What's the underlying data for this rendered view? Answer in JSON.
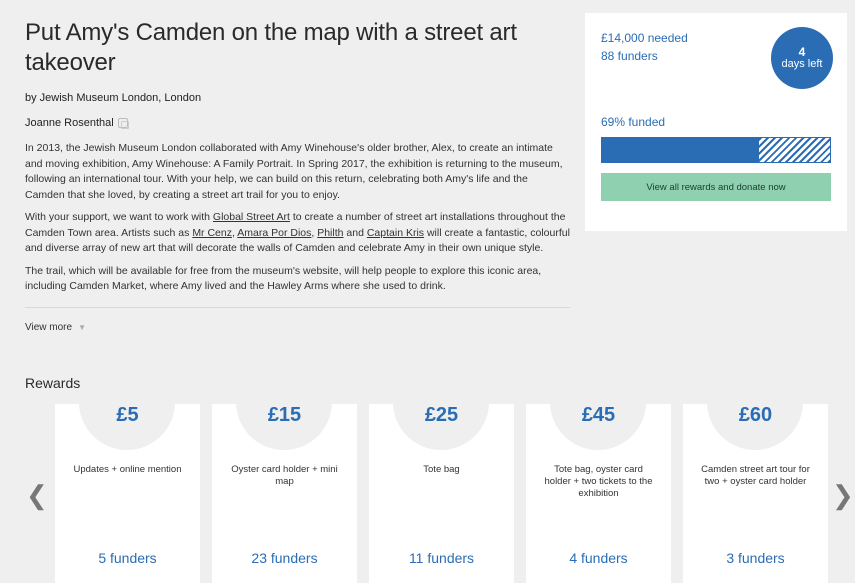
{
  "project": {
    "title": "Put Amy's Camden on the map with a street art takeover",
    "byline": "by Jewish Museum London, London",
    "author": "Joanne Rosenthal",
    "paragraphs": [
      "In 2013, the Jewish Museum London collaborated with Amy Winehouse's older brother, Alex, to create an intimate and moving exhibition, Amy Winehouse: A Family Portrait. In Spring 2017, the exhibition is returning to the museum, following an international tour. With your help, we can build on this return, celebrating both Amy's life and the Camden that she loved, by creating a street art trail for you to enjoy."
    ],
    "p2": {
      "t1": "With your support, we want to work with ",
      "link1": "Global Street Art",
      "t2": " to create a number of street art installations throughout the Camden Town area. Artists such as ",
      "link2": "Mr Cenz",
      "t3": ", ",
      "link3": "Amara Por Dios",
      "t4": ", ",
      "link4": "Philth",
      "t5": " and ",
      "link5": "Captain Kris",
      "t6": " will create a fantastic, colourful and diverse array of new art that will decorate the walls of Camden and celebrate Amy in their own unique style."
    },
    "p3": "The trail, which will be available for free from the museum's website, will help people to explore this iconic area, including Camden Market, where Amy lived and the Hawley Arms where she used to drink.",
    "view_more": "View more"
  },
  "sidebar": {
    "needed": "£14,000 needed",
    "funders": "88 funders",
    "days_num": "4",
    "days_label": "days left",
    "funded_label": "69% funded",
    "funded_fraction": 0.69,
    "donate_label": "View all rewards and donate now"
  },
  "rewards": {
    "heading": "Rewards",
    "items": [
      {
        "price": "£5",
        "desc": "Updates + online mention",
        "funders": "5 funders"
      },
      {
        "price": "£15",
        "desc": "Oyster card holder + mini map",
        "funders": "23 funders"
      },
      {
        "price": "£25",
        "desc": "Tote bag",
        "funders": "11 funders"
      },
      {
        "price": "£45",
        "desc": "Tote bag, oyster card holder + two tickets to the exhibition",
        "funders": "4 funders"
      },
      {
        "price": "£60",
        "desc": "Camden street art tour for two + oyster card holder",
        "funders": "3 funders"
      }
    ]
  },
  "colors": {
    "accent": "#2a6db5",
    "button": "#8fd0b0",
    "background": "#efefef"
  }
}
